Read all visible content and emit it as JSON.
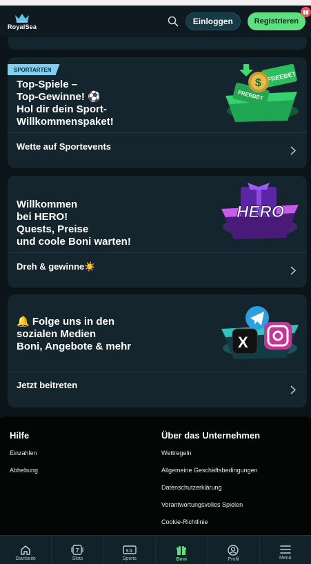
{
  "header": {
    "logo_text": "RoyalSea",
    "login_label": "Einloggen",
    "register_label": "Registrieren",
    "icons": [
      "crown-icon",
      "search-icon",
      "gift-icon"
    ]
  },
  "cards": [
    {
      "tag": "SPORTARTEN",
      "title": "Top-Spiele –\nTop-Gewinne! ⚽\nHol dir dein Sport-\nWillkommenspaket!",
      "action": "Wette auf Sportevents",
      "art": "freebet-wallet-art"
    },
    {
      "title": "Willkommen\nbei HERO!\nQuests, Preise\nund coole Boni warten!",
      "action": "Dreh & gewinne☀️",
      "art": "hero-gift-art",
      "art_text": "HERO"
    },
    {
      "title": "🔔 Folge uns in den\nsozialen Medien\nBoni, Angebote & mehr",
      "action": "Jetzt beitreten",
      "art": "social-media-art"
    }
  ],
  "footer": {
    "help": {
      "heading": "Hilfe",
      "links": [
        "Einzahlen",
        "Abhebung"
      ]
    },
    "company": {
      "heading": "Über das Unternehmen",
      "links": [
        "Wettregeln",
        "Allgemeine Geschäftsbedingungen",
        "Datenschutzerklärung",
        "Verantwortungsvolles Spielen",
        "Cookie-Richtlinie"
      ]
    }
  },
  "bottom_nav": [
    {
      "label": "Startseite",
      "icon": "home-icon"
    },
    {
      "label": "Slots",
      "icon": "slot-machine-icon"
    },
    {
      "label": "Sports",
      "icon": "scoreboard-icon"
    },
    {
      "label": "Boni",
      "icon": "gift-icon",
      "active": true
    },
    {
      "label": "Profil",
      "icon": "user-icon"
    },
    {
      "label": "Menü",
      "icon": "menu-icon"
    }
  ],
  "colors": {
    "accent_green": "#5ee080",
    "card_bg": "#14252e",
    "page_bg": "#0b1419",
    "tag_bg": "#7fd0f0",
    "badge_red": "#ff4d5a"
  }
}
